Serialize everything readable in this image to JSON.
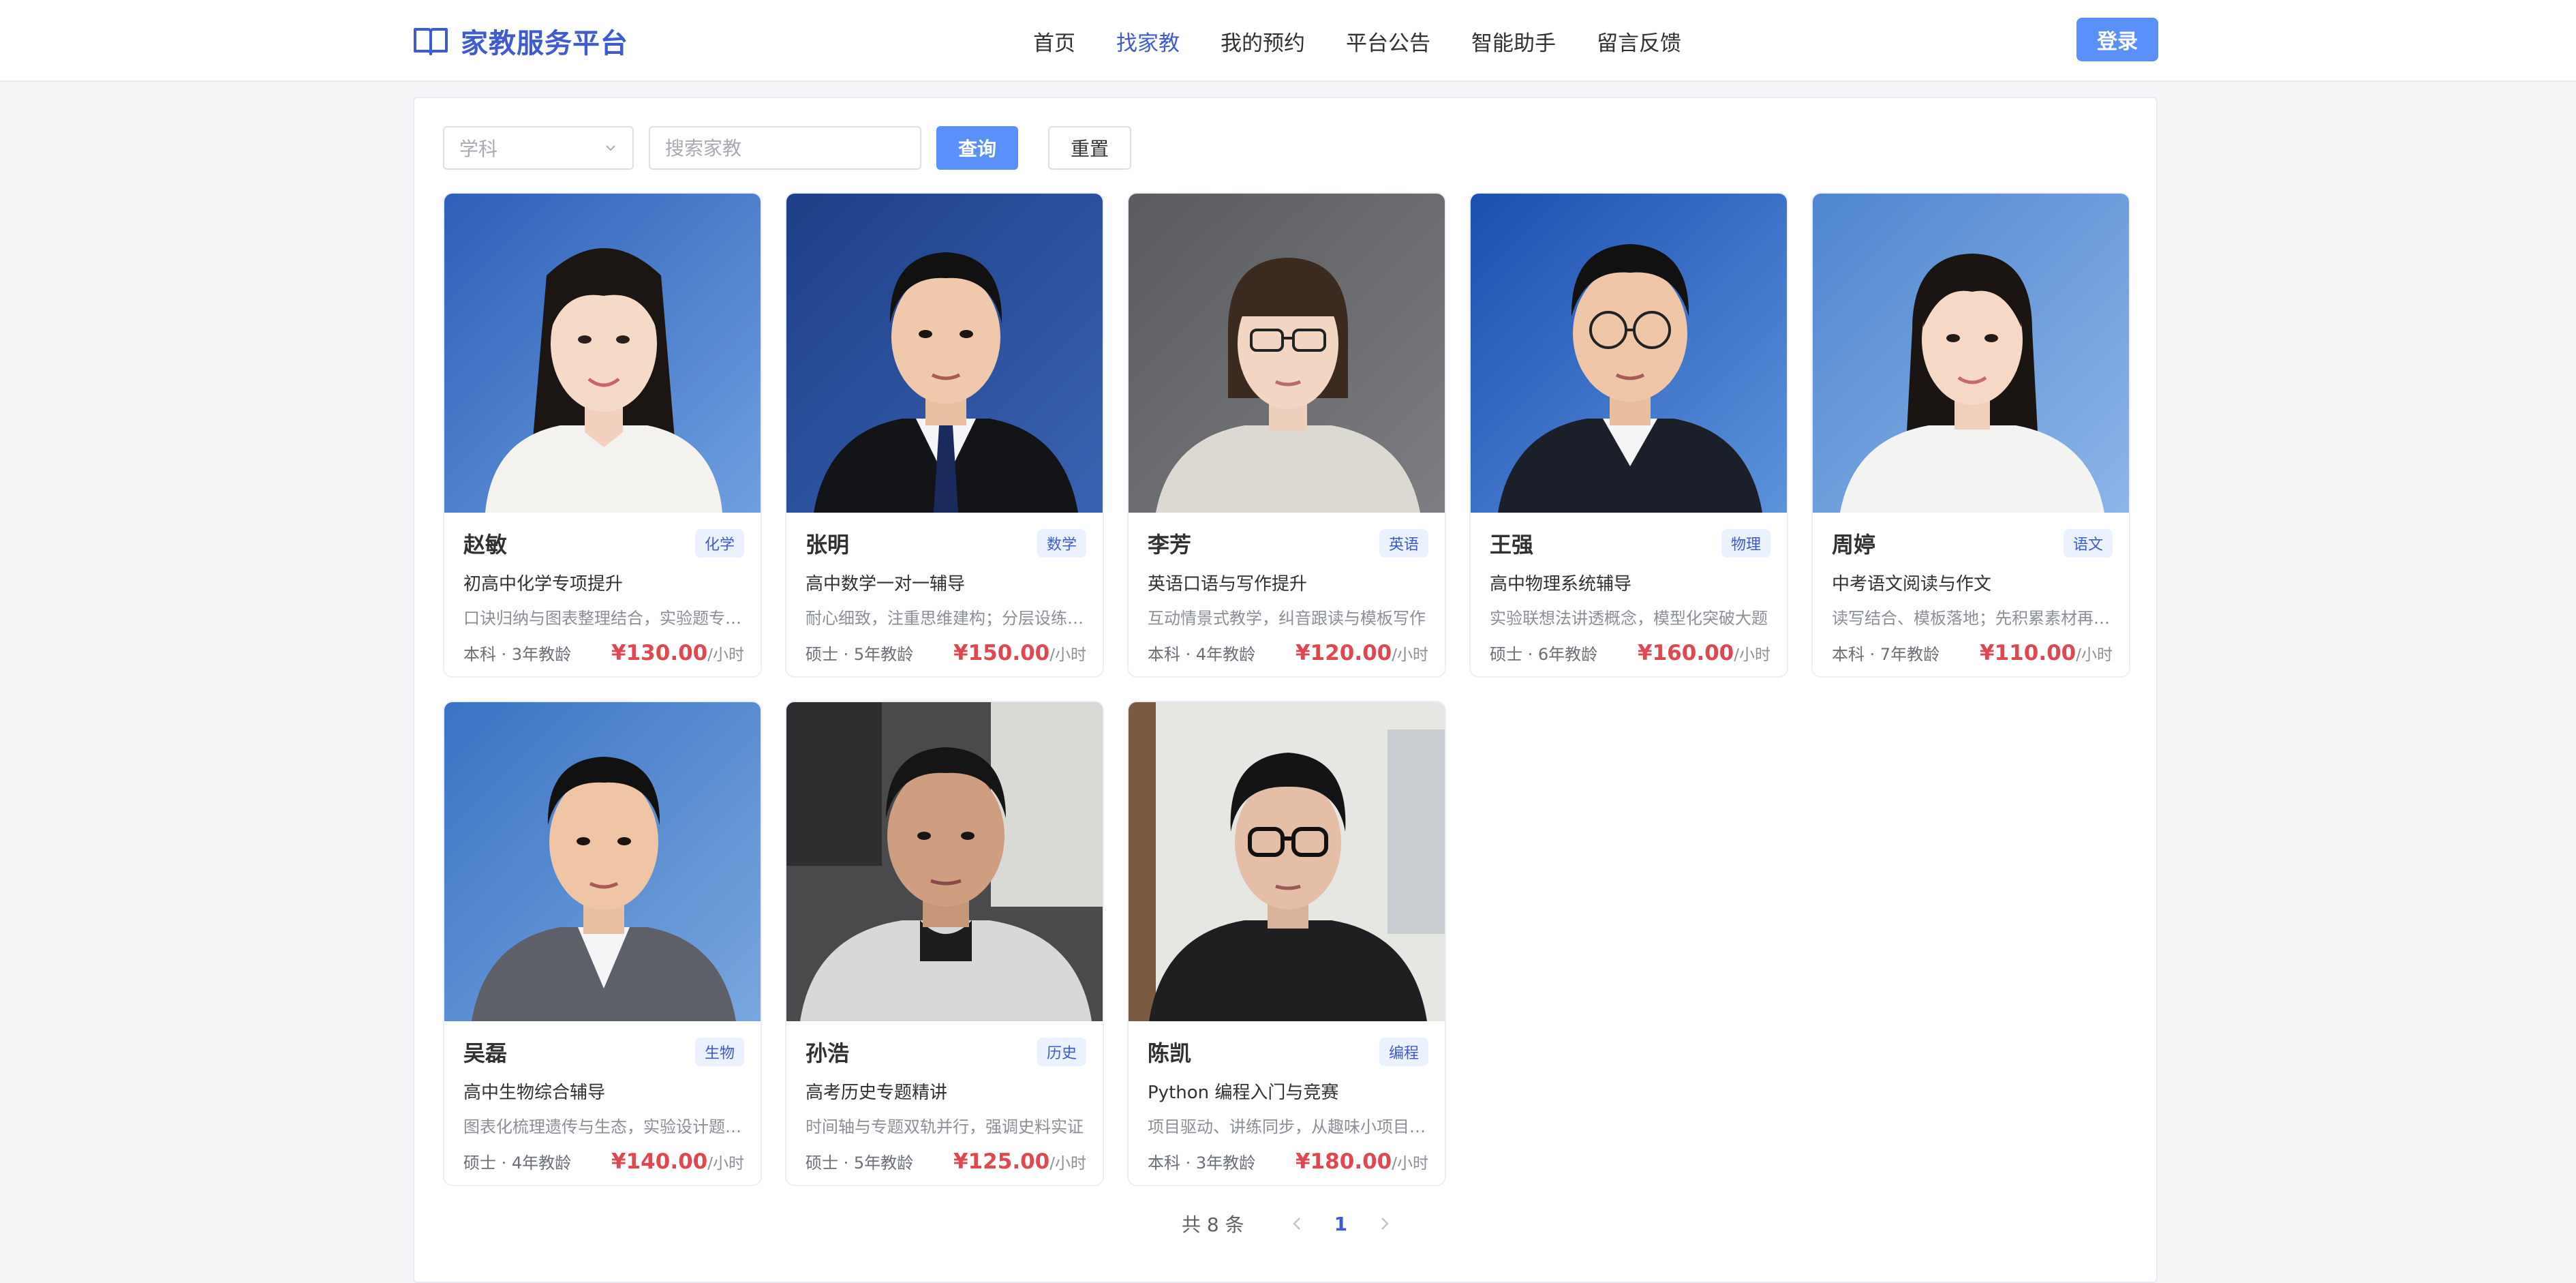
{
  "header": {
    "brand": "家教服务平台",
    "nav": [
      "首页",
      "找家教",
      "我的预约",
      "平台公告",
      "智能助手",
      "留言反馈"
    ],
    "active_nav": "找家教",
    "login": "登录"
  },
  "filter": {
    "subject_placeholder": "学科",
    "search_placeholder": "搜索家教",
    "query": "查询",
    "reset": "重置"
  },
  "tutors": [
    {
      "name": "赵敏",
      "subject": "化学",
      "title": "初高中化学专项提升",
      "desc": "口诀归纳与图表整理结合，实验题专项突破",
      "meta": "本科 · 3年教龄",
      "price": "¥130.00",
      "unit": "/小时"
    },
    {
      "name": "张明",
      "subject": "数学",
      "title": "高中数学一对一辅导",
      "desc": "耐心细致，注重思维建构；分层设练提分",
      "meta": "硕士 · 5年教龄",
      "price": "¥150.00",
      "unit": "/小时"
    },
    {
      "name": "李芳",
      "subject": "英语",
      "title": "英语口语与写作提升",
      "desc": "互动情景式教学，纠音跟读与模板写作",
      "meta": "本科 · 4年教龄",
      "price": "¥120.00",
      "unit": "/小时"
    },
    {
      "name": "王强",
      "subject": "物理",
      "title": "高中物理系统辅导",
      "desc": "实验联想法讲透概念，模型化突破大题",
      "meta": "硕士 · 6年教龄",
      "price": "¥160.00",
      "unit": "/小时"
    },
    {
      "name": "周婷",
      "subject": "语文",
      "title": "中考语文阅读与作文",
      "desc": "读写结合、模板落地；先积累素材再练笔",
      "meta": "本科 · 7年教龄",
      "price": "¥110.00",
      "unit": "/小时"
    },
    {
      "name": "吴磊",
      "subject": "生物",
      "title": "高中生物综合辅导",
      "desc": "图表化梳理遗传与生态，实验设计题专练",
      "meta": "硕士 · 4年教龄",
      "price": "¥140.00",
      "unit": "/小时"
    },
    {
      "name": "孙浩",
      "subject": "历史",
      "title": "高考历史专题精讲",
      "desc": "时间轴与专题双轨并行，强调史料实证",
      "meta": "硕士 · 5年教龄",
      "price": "¥125.00",
      "unit": "/小时"
    },
    {
      "name": "陈凯",
      "subject": "编程",
      "title": "Python 编程入门与竞赛",
      "desc": "项目驱动、讲练同步，从趣味小项目入门",
      "meta": "本科 · 3年教龄",
      "price": "¥180.00",
      "unit": "/小时"
    }
  ],
  "pagination": {
    "total": "共 8 条",
    "current": "1"
  },
  "colors": {
    "primary": "#5b8ff9",
    "brand": "#3f5bd4",
    "price": "#e0474f"
  }
}
